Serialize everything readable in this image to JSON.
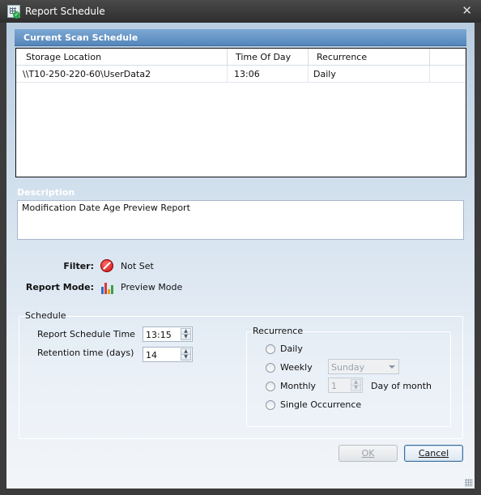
{
  "window": {
    "title": "Report Schedule",
    "close_symbol": "✕"
  },
  "current_scan": {
    "header": "Current Scan Schedule",
    "columns": [
      "Storage Location",
      "Time Of Day",
      "Recurrence",
      ""
    ],
    "rows": [
      [
        "\\\\T10-250-220-60\\UserData2",
        "13:06",
        "Daily",
        ""
      ]
    ]
  },
  "description": {
    "label": "Description",
    "value": "Modification Date Age Preview Report"
  },
  "info": {
    "filter_label": "Filter:",
    "filter_value": "Not Set",
    "mode_label": "Report Mode:",
    "mode_value": "Preview Mode"
  },
  "schedule": {
    "title": "Schedule",
    "time_label": "Report Schedule Time",
    "time_value": "13:15",
    "retention_label": "Retention time (days)",
    "retention_value": "14"
  },
  "recurrence": {
    "title": "Recurrence",
    "options": [
      "Daily",
      "Weekly",
      "Monthly",
      "Single Occurrence"
    ],
    "weekly_day": "Sunday",
    "monthly_day": "1",
    "day_of_month_label": "Day of month"
  },
  "buttons": {
    "ok": "OK",
    "cancel": "Cancel"
  },
  "colors": {
    "header_blue": "#5486bb",
    "title_bar": "#3a3a3a",
    "cancel_border": "#3d6f9e"
  },
  "icons": {
    "app": "report-schedule-icon",
    "filter": "no-filter-icon",
    "mode": "bar-chart-icon"
  }
}
